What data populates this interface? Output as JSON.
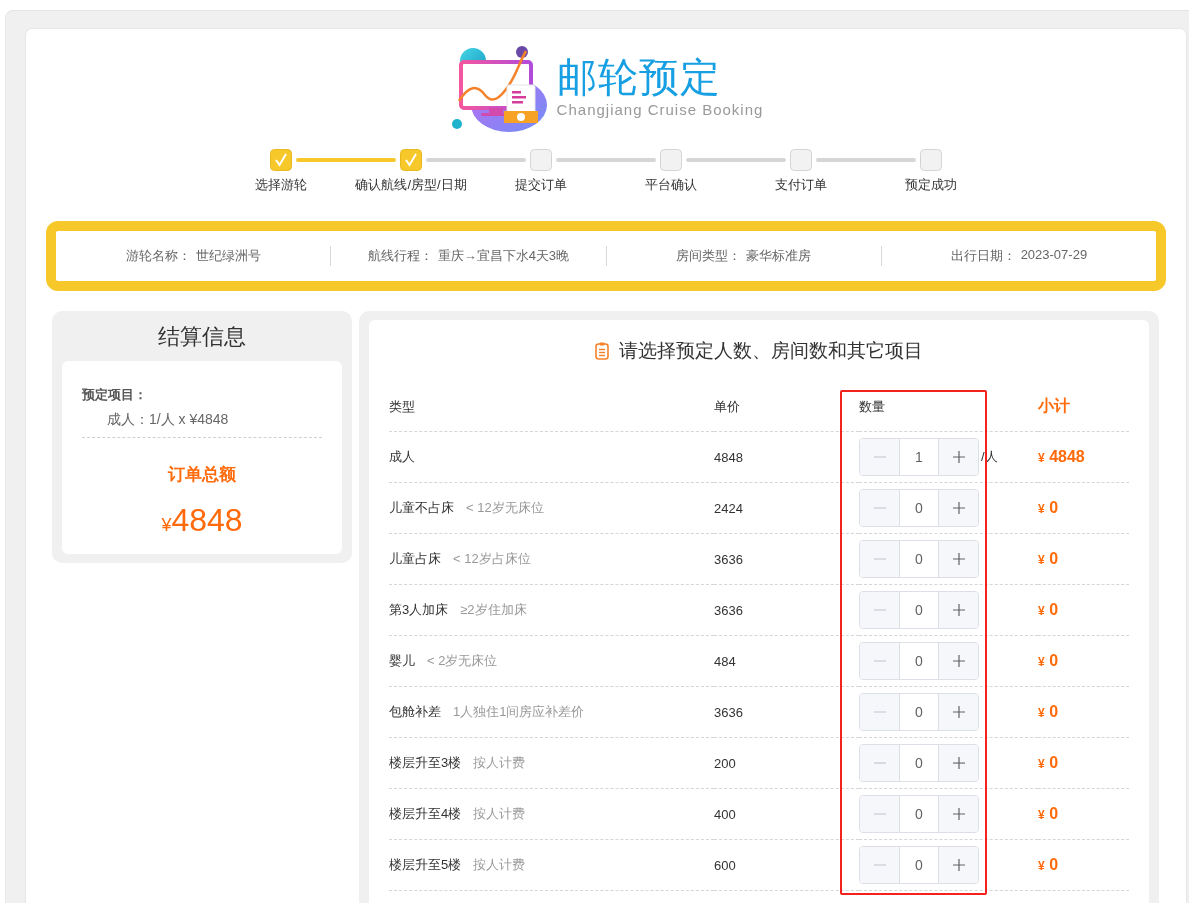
{
  "header": {
    "title": "邮轮预定",
    "subtitle": "Changjiang Cruise Booking"
  },
  "steps": [
    {
      "label": "选择游轮",
      "done": true
    },
    {
      "label": "确认航线/房型/日期",
      "done": true
    },
    {
      "label": "提交订单",
      "done": false
    },
    {
      "label": "平台确认",
      "done": false
    },
    {
      "label": "支付订单",
      "done": false
    },
    {
      "label": "预定成功",
      "done": false
    }
  ],
  "trip_info": [
    {
      "label": "游轮名称：",
      "value": "世纪绿洲号"
    },
    {
      "label": "航线行程：",
      "value": "重庆→宜昌下水4天3晚"
    },
    {
      "label": "房间类型：",
      "value": "豪华标准房"
    },
    {
      "label": "出行日期：",
      "value": "2023-07-29"
    }
  ],
  "summary": {
    "title": "结算信息",
    "items_label": "预定项目：",
    "items": [
      "成人：1/人 x ¥4848"
    ],
    "total_label": "订单总额",
    "total_currency": "¥",
    "total": "4848"
  },
  "selection": {
    "title": "请选择预定人数、房间数和其它项目",
    "columns": [
      {
        "label": "类型",
        "highlighted": false
      },
      {
        "label": "单价",
        "highlighted": false
      },
      {
        "label": "数量",
        "highlighted": true
      },
      {
        "label": "小计",
        "highlighted": false
      }
    ],
    "rows": [
      {
        "name": "成人",
        "price": "4848",
        "quantity": "1",
        "minus_disabled": true,
        "unit": "/人",
        "currency": "¥",
        "subtotal": "4848"
      },
      {
        "name": "儿童不占床",
        "note": "< 12岁无床位",
        "price": "2424",
        "quantity": "0",
        "minus_disabled": true,
        "currency": "¥",
        "subtotal": "0"
      },
      {
        "name": "儿童占床",
        "note": "< 12岁占床位",
        "price": "3636",
        "quantity": "0",
        "minus_disabled": true,
        "currency": "¥",
        "subtotal": "0"
      },
      {
        "name": "第3人加床",
        "note": "≥2岁住加床",
        "price": "3636",
        "quantity": "0",
        "minus_disabled": true,
        "currency": "¥",
        "subtotal": "0"
      },
      {
        "name": "婴儿",
        "note": "< 2岁无床位",
        "price": "484",
        "quantity": "0",
        "minus_disabled": true,
        "currency": "¥",
        "subtotal": "0"
      },
      {
        "name": "包舱补差",
        "note": "1人独住1间房应补差价",
        "price": "3636",
        "quantity": "0",
        "minus_disabled": true,
        "currency": "¥",
        "subtotal": "0"
      },
      {
        "name": "楼层升至3楼",
        "note": "按人计费",
        "price": "200",
        "quantity": "0",
        "minus_disabled": true,
        "currency": "¥",
        "subtotal": "0"
      },
      {
        "name": "楼层升至4楼",
        "note": "按人计费",
        "price": "400",
        "quantity": "0",
        "minus_disabled": true,
        "currency": "¥",
        "subtotal": "0"
      },
      {
        "name": "楼层升至5楼",
        "note": "按人计费",
        "price": "600",
        "quantity": "0",
        "minus_disabled": true,
        "currency": "¥",
        "subtotal": "0"
      }
    ]
  }
}
